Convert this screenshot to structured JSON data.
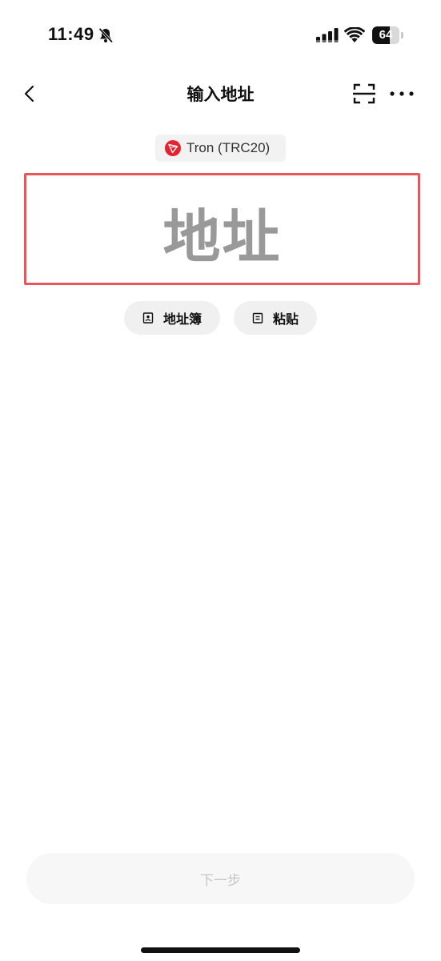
{
  "status_bar": {
    "time": "11:49",
    "battery_percent": "64",
    "battery_level": 0.64,
    "icons": [
      "bell-off-icon",
      "signal-icon",
      "wifi-icon",
      "battery-icon"
    ]
  },
  "nav": {
    "title": "输入地址",
    "icons": [
      "chevron-left-icon",
      "scan-icon",
      "more-icon"
    ]
  },
  "network": {
    "label": "Tron (TRC20)",
    "icon": "tron-icon",
    "icon_color": "#e5232f"
  },
  "address_input": {
    "placeholder": "地址",
    "border_color": "#e8555b"
  },
  "actions": {
    "address_book_label": "地址簿",
    "paste_label": "粘贴"
  },
  "footer": {
    "next_label": "下一步"
  }
}
